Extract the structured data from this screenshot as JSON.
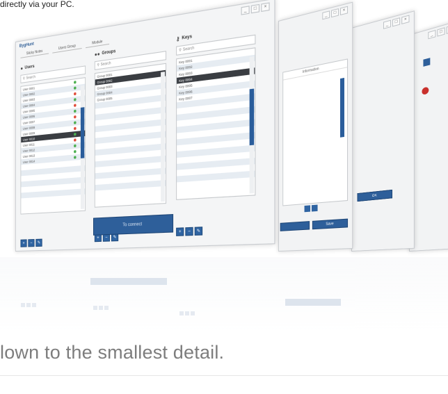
{
  "intro_text": "directly via your PC.",
  "headline": "lown to the smallest detail.",
  "app": {
    "title": "BygHunt",
    "tabs": [
      "Sticky Notes",
      "Users Group",
      "Module"
    ]
  },
  "columns": {
    "users": {
      "header": "Users",
      "search": "Search",
      "rows": [
        "User 0001",
        "User 0002",
        "User 0003",
        "User 0004",
        "User 0005",
        "User 0006",
        "User 0007",
        "User 0008",
        "User 0009",
        "User 0010",
        "User 0011",
        "User 0012",
        "User 0013",
        "User 0014"
      ],
      "selected_index": 9,
      "dots": [
        "#4caf50",
        "#4caf50",
        "#e04b3a",
        "#4caf50",
        "#e04b3a",
        "#4caf50",
        "#e04b3a",
        "#4caf50",
        "#e04b3a",
        "#4caf50",
        "#e04b3a",
        "#4caf50",
        "#4caf50",
        "#4caf50"
      ]
    },
    "groups": {
      "header": "Groups",
      "search": "Search",
      "rows": [
        "Group 0001",
        "Group 0002",
        "Group 0003",
        "Group 0004",
        "Group 0005"
      ],
      "selected_index": 1
    },
    "keys": {
      "header": "Keys",
      "search": "Search",
      "rows": [
        "Key 0001",
        "Key 0002",
        "Key 0003",
        "Key 0004",
        "Key 0005",
        "Key 0006",
        "Key 0007"
      ],
      "selected_index": 3
    }
  },
  "buttons": {
    "connect": "To connect",
    "small": [
      "+",
      "−",
      "✎"
    ],
    "window2_save": "Save",
    "window3_ok": "OK"
  },
  "window2": {
    "column_header": "Information"
  },
  "window_controls": [
    "_",
    "□",
    "×"
  ],
  "colors": {
    "accent": "#2e5f9a",
    "selected_row": "#3a3d42",
    "headline": "#7d7d7d"
  }
}
